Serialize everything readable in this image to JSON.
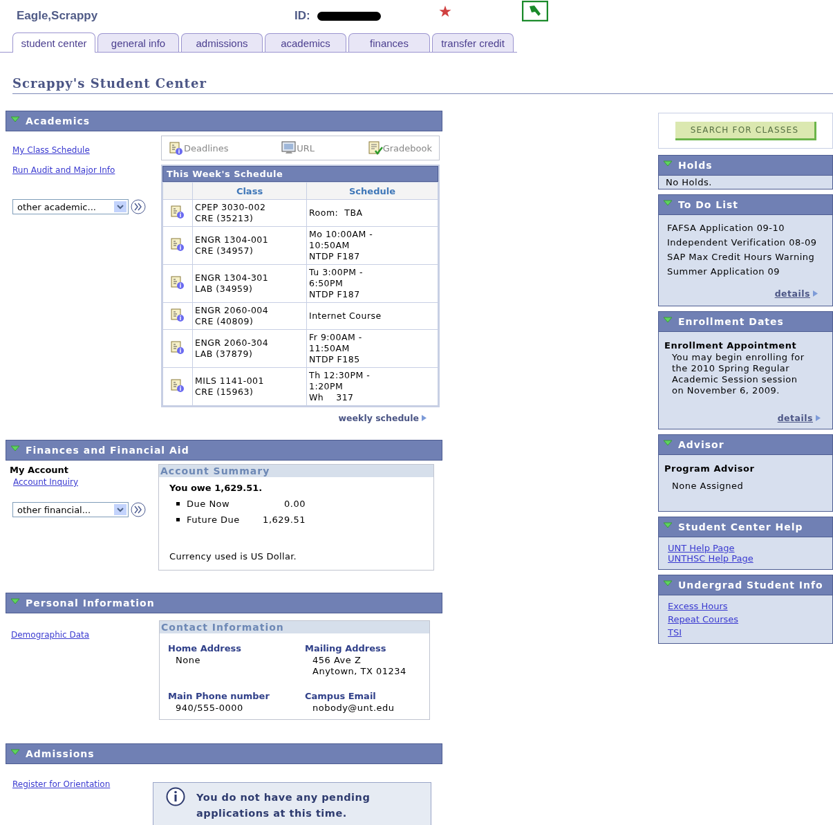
{
  "header": {
    "name": "Eagle,Scrappy",
    "id_label": "ID:"
  },
  "tabs": [
    {
      "label": "student center",
      "selected": true
    },
    {
      "label": "general info",
      "selected": false
    },
    {
      "label": "admissions",
      "selected": false
    },
    {
      "label": "academics",
      "selected": false
    },
    {
      "label": "finances",
      "selected": false
    },
    {
      "label": "transfer credit",
      "selected": false
    }
  ],
  "page_title": "Scrappy's Student Center",
  "academics": {
    "title": "Academics",
    "links": [
      "My Class Schedule",
      "Run Audit and Major Info"
    ],
    "dropdown": {
      "value": "other academic..."
    },
    "toolbar": [
      {
        "kind": "deadlines",
        "label": "Deadlines"
      },
      {
        "kind": "url",
        "label": "URL"
      },
      {
        "kind": "gradebook",
        "label": "Gradebook"
      }
    ],
    "schedule": {
      "title": "This Week's Schedule",
      "columns": [
        "Class",
        "Schedule"
      ],
      "rows": [
        {
          "class": [
            "CPEP 3030-002",
            "CRE (35213)"
          ],
          "schedule": [
            "Room:  TBA"
          ]
        },
        {
          "class": [
            "ENGR 1304-001",
            "CRE (34957)"
          ],
          "schedule": [
            "Mo 10:00AM -",
            "10:50AM",
            "NTDP F187"
          ]
        },
        {
          "class": [
            "ENGR 1304-301",
            "LAB (34959)"
          ],
          "schedule": [
            "Tu 3:00PM -",
            "6:50PM",
            "NTDP F187"
          ]
        },
        {
          "class": [
            "ENGR 2060-004",
            "CRE (40809)"
          ],
          "schedule": [
            "Internet Course"
          ]
        },
        {
          "class": [
            "ENGR 2060-304",
            "LAB (37879)"
          ],
          "schedule": [
            "Fr 9:00AM -",
            "11:50AM",
            "NTDP F185"
          ]
        },
        {
          "class": [
            "MILS 1141-001",
            "CRE (15963)"
          ],
          "schedule": [
            "Th 12:30PM -",
            "1:20PM",
            "Wh    317"
          ]
        }
      ],
      "footer_link": "weekly schedule"
    }
  },
  "finances": {
    "title": "Finances and Financial Aid",
    "account_label": "My Account",
    "links": [
      "Account Inquiry"
    ],
    "dropdown": {
      "value": "other financial..."
    },
    "summary": {
      "title": "Account Summary",
      "owe": "You owe 1,629.51.",
      "items": [
        {
          "label": "Due Now",
          "amount": "0.00"
        },
        {
          "label": "Future Due",
          "amount": "1,629.51"
        }
      ],
      "note": "Currency used is US Dollar."
    }
  },
  "personal": {
    "title": "Personal Information",
    "links": [
      "Demographic Data"
    ],
    "contact": {
      "title": "Contact Information",
      "fields": [
        {
          "label": "Home Address",
          "lines": [
            "None"
          ]
        },
        {
          "label": "Mailing Address",
          "lines": [
            "456 Ave Z",
            "Anytown, TX 01234"
          ]
        },
        {
          "label": "Main Phone number",
          "lines": [
            "940/555-0000"
          ]
        },
        {
          "label": "Campus Email",
          "lines": [
            "nobody@unt.edu"
          ]
        }
      ]
    }
  },
  "admissions": {
    "title": "Admissions",
    "links": [
      "Register for Orientation"
    ],
    "message": "You do not have any pending applications at this time."
  },
  "search_button": "SEARCH FOR CLASSES",
  "panels": [
    {
      "kind": "plain",
      "title": "Holds",
      "lines": [
        "No Holds."
      ]
    },
    {
      "kind": "list",
      "title": "To Do List",
      "items": [
        "FAFSA Application 09-10",
        "Independent Verification 08-09",
        "SAP Max Credit Hours Warning",
        "Summer Application 09"
      ],
      "details": "details"
    },
    {
      "kind": "note",
      "title": "Enrollment Dates",
      "heading": "Enrollment Appointment",
      "body": "You may begin enrolling for the 2010 Spring Regular Academic Session session on November 6, 2009.",
      "details": "details"
    },
    {
      "kind": "note",
      "title": "Advisor",
      "heading": "Program Advisor",
      "body": "None Assigned"
    },
    {
      "kind": "links",
      "title": "Student Center Help",
      "links": [
        "UNT Help Page",
        "UNTHSC Help Page"
      ]
    },
    {
      "kind": "links",
      "title": "Undergrad Student Info",
      "links": [
        "Excess Hours",
        "Repeat Courses",
        "TSI"
      ]
    }
  ]
}
